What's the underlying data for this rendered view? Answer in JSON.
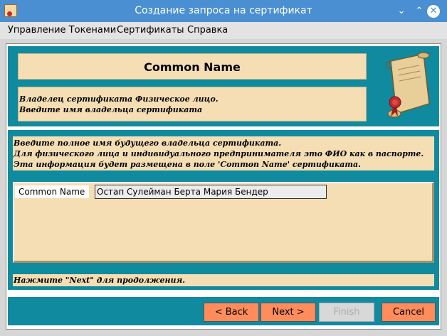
{
  "window": {
    "title": "Создание запроса на сертификат",
    "icon": "certificate-app-icon"
  },
  "menubar": {
    "items": [
      "Управление Токенами",
      "Сертификаты",
      "Справка"
    ]
  },
  "header": {
    "title": "Common Name"
  },
  "owner": {
    "line1": "Владелец сертификата Физическое лицо.",
    "line2": "Введите имя владельца сертификата"
  },
  "instructions": {
    "line1": "Введите полное имя будущего владельца сертификата.",
    "line2": "Для физического лица и индивидуального предпринимателя это ФИО как в паспорте.",
    "line3": "Эта информация будет размещена в поле 'Common Name' сертификата."
  },
  "form": {
    "label": "Common Name",
    "value": "Остап Сулейман Берта Мария Бендер"
  },
  "hint": "Нажмите \"Next\" для продолжения.",
  "buttons": {
    "back": "< Back",
    "next": "Next >",
    "finish": "Finish",
    "cancel": "Cancel"
  },
  "colors": {
    "titlebar": "#4a8fd1",
    "panel": "#0f8a9e",
    "tan": "#f5deb3",
    "button": "#ff8c5a"
  }
}
